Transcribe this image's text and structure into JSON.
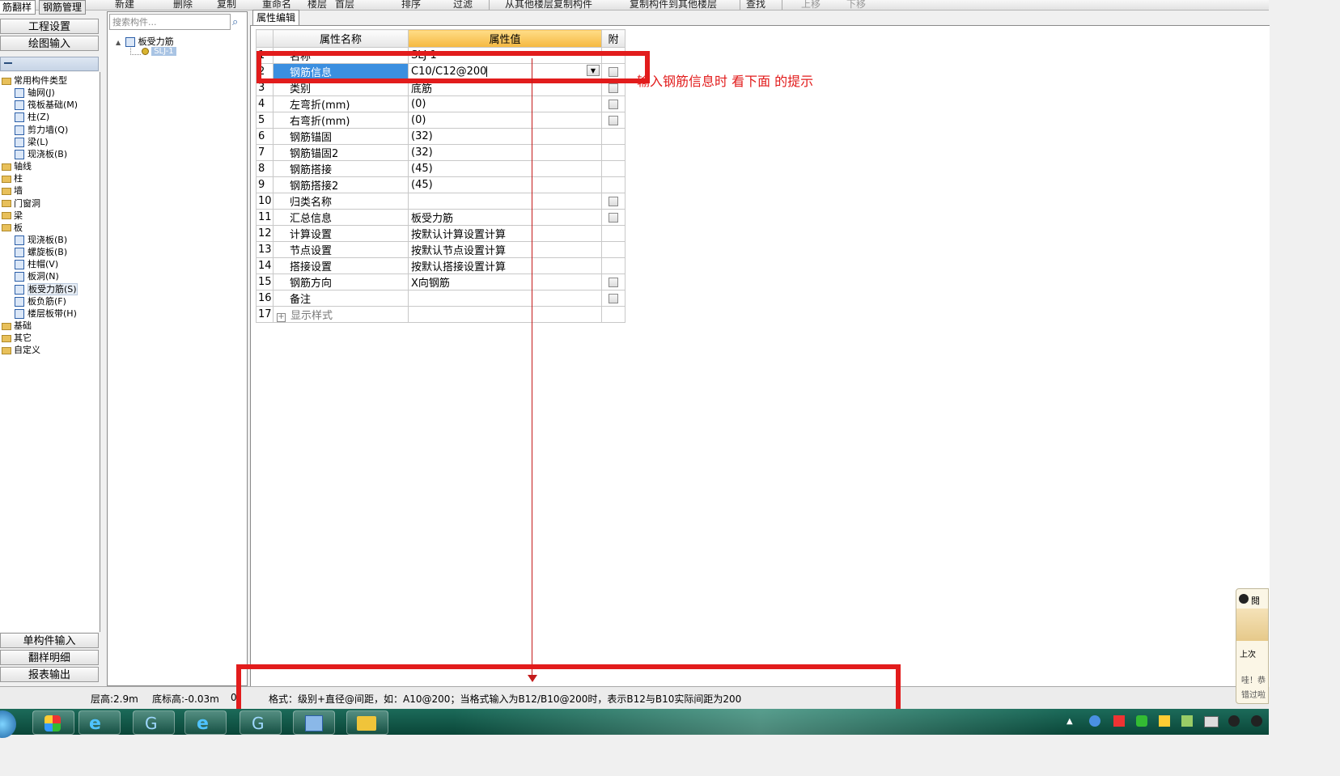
{
  "toolbar": {
    "items": [
      "新建",
      "删除",
      "复制",
      "重命名",
      "楼层",
      "首层",
      "排序",
      "过滤",
      "从其他楼层复制构件",
      "复制构件到其他楼层",
      "查找",
      "上移",
      "下移"
    ]
  },
  "left_tabs": [
    "筋翻样",
    "钢筋管理"
  ],
  "left_buttons": {
    "project_settings": "工程设置",
    "drawing_input": "绘图输入",
    "single_component_input": "单构件输入",
    "detail": "翻样明细",
    "report_output": "报表输出"
  },
  "tree": [
    {
      "label": "常用构件类型",
      "type": "folder",
      "level": 0
    },
    {
      "label": "轴网(J)",
      "type": "item",
      "level": 1
    },
    {
      "label": "筏板基础(M)",
      "type": "item",
      "level": 1
    },
    {
      "label": "柱(Z)",
      "type": "item",
      "level": 1
    },
    {
      "label": "剪力墙(Q)",
      "type": "item",
      "level": 1
    },
    {
      "label": "梁(L)",
      "type": "item",
      "level": 1
    },
    {
      "label": "现浇板(B)",
      "type": "item",
      "level": 1
    },
    {
      "label": "轴线",
      "type": "folder",
      "level": 0
    },
    {
      "label": "柱",
      "type": "folder",
      "level": 0
    },
    {
      "label": "墙",
      "type": "folder",
      "level": 0
    },
    {
      "label": "门窗洞",
      "type": "folder",
      "level": 0
    },
    {
      "label": "梁",
      "type": "folder",
      "level": 0
    },
    {
      "label": "板",
      "type": "folder",
      "level": 0
    },
    {
      "label": "现浇板(B)",
      "type": "item",
      "level": 1
    },
    {
      "label": "螺旋板(B)",
      "type": "item",
      "level": 1
    },
    {
      "label": "柱帽(V)",
      "type": "item",
      "level": 1
    },
    {
      "label": "板洞(N)",
      "type": "item",
      "level": 1
    },
    {
      "label": "板受力筋(S)",
      "type": "item",
      "level": 1,
      "selected": true
    },
    {
      "label": "板负筋(F)",
      "type": "item",
      "level": 1
    },
    {
      "label": "楼层板带(H)",
      "type": "item",
      "level": 1
    },
    {
      "label": "基础",
      "type": "folder",
      "level": 0
    },
    {
      "label": "其它",
      "type": "folder",
      "level": 0
    },
    {
      "label": "自定义",
      "type": "folder",
      "level": 0
    }
  ],
  "middle": {
    "search_placeholder": "搜索构件...",
    "tree_parent": "板受力筋",
    "tree_child": "SLJ-1"
  },
  "prop_tab": "属性编辑",
  "props": {
    "headers": {
      "name": "属性名称",
      "value": "属性值",
      "attach": "附"
    },
    "rows": [
      {
        "num": "1",
        "name": "名称",
        "value": "SLJ-1",
        "cb": false
      },
      {
        "num": "2",
        "name": "钢筋信息",
        "value": "C10/C12@200",
        "cb": true,
        "selected": true
      },
      {
        "num": "3",
        "name": "类别",
        "value": "底筋",
        "cb": true
      },
      {
        "num": "4",
        "name": "左弯折(mm)",
        "value": "(0)",
        "cb": true
      },
      {
        "num": "5",
        "name": "右弯折(mm)",
        "value": "(0)",
        "cb": true
      },
      {
        "num": "6",
        "name": "钢筋锚固",
        "value": "(32)",
        "cb": false
      },
      {
        "num": "7",
        "name": "钢筋锚固2",
        "value": "(32)",
        "cb": false
      },
      {
        "num": "8",
        "name": "钢筋搭接",
        "value": "(45)",
        "cb": false
      },
      {
        "num": "9",
        "name": "钢筋搭接2",
        "value": "(45)",
        "cb": false
      },
      {
        "num": "10",
        "name": "归类名称",
        "value": "",
        "cb": true
      },
      {
        "num": "11",
        "name": "汇总信息",
        "value": "板受力筋",
        "cb": true
      },
      {
        "num": "12",
        "name": "计算设置",
        "value": "按默认计算设置计算",
        "cb": false
      },
      {
        "num": "13",
        "name": "节点设置",
        "value": "按默认节点设置计算",
        "cb": false
      },
      {
        "num": "14",
        "name": "搭接设置",
        "value": "按默认搭接设置计算",
        "cb": false
      },
      {
        "num": "15",
        "name": "钢筋方向",
        "value": "X向钢筋",
        "cb": true
      },
      {
        "num": "16",
        "name": "备注",
        "value": "",
        "cb": true
      },
      {
        "num": "17",
        "name": "显示样式",
        "value": "",
        "cb": false,
        "expander": true
      }
    ]
  },
  "annotation": {
    "text": "输入钢筋信息时 看下面 的提示",
    "color": "#e21c1c"
  },
  "status": {
    "floor_height": "层高:2.9m",
    "base_elevation": "底标高:-0.03m",
    "zero": "0",
    "hint": "格式：级别+直径@间距，如：A10@200；当格式输入为B12/B10@200时，表示B12与B10实际间距为200"
  },
  "notify_popup": {
    "line1": "閱",
    "line2": "上次",
    "line3": "哇！恭",
    "line4": "错过啦"
  },
  "colors": {
    "accent_header": "#f5b840",
    "selection": "#3b8fe0",
    "annotation_red": "#e21c1c"
  }
}
